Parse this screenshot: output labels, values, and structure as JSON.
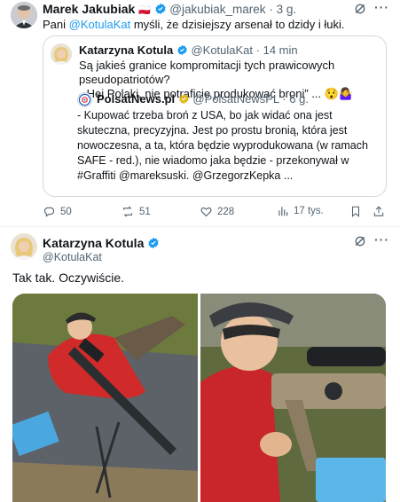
{
  "tweet1": {
    "author_name": "Marek Jakubiak",
    "flag": "🇵🇱",
    "handle": "@jakubiak_marek",
    "time": "· 3 g.",
    "text_before": "Pani ",
    "mention": "@KotulaKat",
    "text_after": " myśli, że dzisiejszy arsenał to dzidy i łuki.",
    "quote": {
      "author_name": "Katarzyna Kotula",
      "handle": "@KotulaKat",
      "time": "· 14 min",
      "line1": "Są jakieś granice kompromitacji tych prawicowych",
      "line2": "pseudopatriotów?",
      "line3": "-„Hej Polaki, nie potraficie produkować broni” ... 😯🤷‍♀️",
      "inner": {
        "author_name": "PolsatNews.pl",
        "handle": "@PolsatNewsPL",
        "time": "· 6 g.",
        "text": "- Kupować trzeba broń z USA, bo jak widać ona jest skuteczna, precyzyjna. Jest po prostu bronią, która jest nowoczesna, a ta, która będzie wyprodukowana (w ramach SAFE - red.), nie wiadomo jaka będzie - przekonywał w #Graffiti @mareksuski. @GrzegorzKepka ..."
      }
    },
    "actions": {
      "replies": "50",
      "reposts": "51",
      "likes": "228",
      "views": "17 tys."
    }
  },
  "tweet2": {
    "author_name": "Katarzyna Kotula",
    "handle": "@KotulaKat",
    "text": "Tak tak. Oczywiście."
  },
  "colors": {
    "accent": "#1d9bf0",
    "muted": "#536471",
    "border": "#cfd9de",
    "polsat_badge": "#e2b719"
  }
}
